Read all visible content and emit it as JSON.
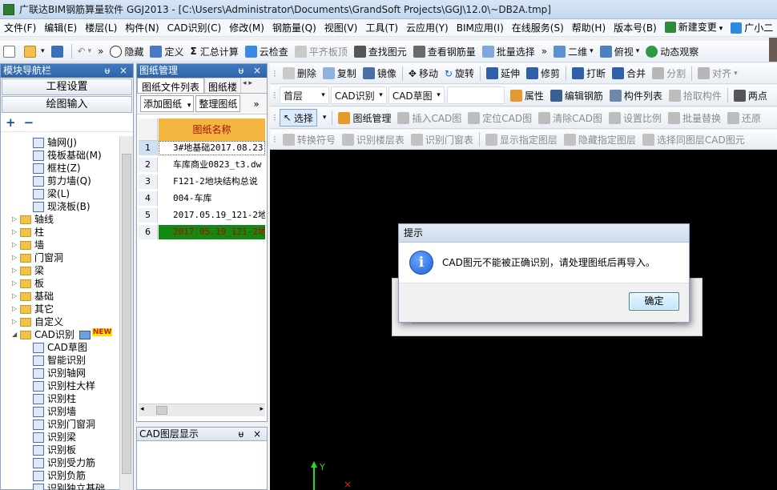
{
  "window": {
    "title": "广联达BIM钢筋算量软件 GGJ2013 - [C:\\Users\\Administrator\\Documents\\GrandSoft Projects\\GGJ\\12.0\\~DB2A.tmp]"
  },
  "menu": [
    "文件(F)",
    "编辑(E)",
    "楼层(L)",
    "构件(N)",
    "CAD识别(C)",
    "修改(M)",
    "钢筋量(Q)",
    "视图(V)",
    "工具(T)",
    "云应用(Y)",
    "BIM应用(I)",
    "在线服务(S)",
    "帮助(H)",
    "版本号(B)",
    "新建变更",
    "广小二"
  ],
  "toolbar1": {
    "items": [
      "隐藏",
      "定义",
      "汇总计算",
      "云检查",
      "平齐板顶",
      "查找图元",
      "查看钢筋量",
      "批量选择",
      "二维",
      "俯视",
      "动态观察"
    ]
  },
  "toolbar2": {
    "items": [
      "删除",
      "复制",
      "镜像",
      "移动",
      "旋转",
      "延伸",
      "修剪",
      "打断",
      "合并",
      "分割",
      "对齐"
    ]
  },
  "toolbar3": {
    "floor": "首层",
    "cad_mode": "CAD识别",
    "cad_type": "CAD草图",
    "items": [
      "属性",
      "编辑钢筋",
      "构件列表",
      "拾取构件",
      "两点"
    ]
  },
  "toolbar4": {
    "select": "选择",
    "items": [
      "图纸管理",
      "插入CAD图",
      "定位CAD图",
      "清除CAD图",
      "设置比例",
      "批量替换",
      "还原"
    ]
  },
  "toolbar5": {
    "items": [
      "转换符号",
      "识别楼层表",
      "识别门窗表",
      "显示指定图层",
      "隐藏指定图层",
      "选择同图层CAD图元"
    ]
  },
  "module_nav": {
    "title": "模块导航栏",
    "btn_project": "工程设置",
    "btn_draw": "绘图输入",
    "plus": "+",
    "minus": "−",
    "tree": [
      {
        "label": "轴网(J)",
        "level": 2,
        "type": "leaf"
      },
      {
        "label": "筏板基础(M)",
        "level": 2,
        "type": "leaf"
      },
      {
        "label": "框柱(Z)",
        "level": 2,
        "type": "leaf"
      },
      {
        "label": "剪力墙(Q)",
        "level": 2,
        "type": "leaf"
      },
      {
        "label": "梁(L)",
        "level": 2,
        "type": "leaf"
      },
      {
        "label": "现浇板(B)",
        "level": 2,
        "type": "leaf"
      },
      {
        "label": "轴线",
        "level": 1,
        "type": "folder"
      },
      {
        "label": "柱",
        "level": 1,
        "type": "folder"
      },
      {
        "label": "墙",
        "level": 1,
        "type": "folder"
      },
      {
        "label": "门窗洞",
        "level": 1,
        "type": "folder"
      },
      {
        "label": "梁",
        "level": 1,
        "type": "folder"
      },
      {
        "label": "板",
        "level": 1,
        "type": "folder"
      },
      {
        "label": "基础",
        "level": 1,
        "type": "folder"
      },
      {
        "label": "其它",
        "level": 1,
        "type": "folder"
      },
      {
        "label": "自定义",
        "level": 1,
        "type": "folder"
      },
      {
        "label": "CAD识别",
        "level": 1,
        "type": "folder",
        "open": true,
        "badge": "NEW"
      },
      {
        "label": "CAD草图",
        "level": 2,
        "type": "leaf"
      },
      {
        "label": "智能识别",
        "level": 2,
        "type": "leaf"
      },
      {
        "label": "识别轴网",
        "level": 2,
        "type": "leaf"
      },
      {
        "label": "识别柱大样",
        "level": 2,
        "type": "leaf"
      },
      {
        "label": "识别柱",
        "level": 2,
        "type": "leaf"
      },
      {
        "label": "识别墙",
        "level": 2,
        "type": "leaf"
      },
      {
        "label": "识别门窗洞",
        "level": 2,
        "type": "leaf"
      },
      {
        "label": "识别梁",
        "level": 2,
        "type": "leaf"
      },
      {
        "label": "识别板",
        "level": 2,
        "type": "leaf"
      },
      {
        "label": "识别受力筋",
        "level": 2,
        "type": "leaf"
      },
      {
        "label": "识别负筋",
        "level": 2,
        "type": "leaf"
      },
      {
        "label": "识别独立基础",
        "level": 2,
        "type": "leaf"
      }
    ]
  },
  "drawing_mgmt": {
    "title": "图纸管理",
    "tab_files": "图纸文件列表",
    "tab_floor": "图纸楼",
    "btn_add": "添加图纸",
    "btn_arrange": "整理图纸",
    "col_header": "图纸名称",
    "rows": [
      {
        "num": "1",
        "name": "3#地基础2017.08.23"
      },
      {
        "num": "2",
        "name": "车库商业0823_t3.dw"
      },
      {
        "num": "3",
        "name": "F121-2地块结构总说"
      },
      {
        "num": "4",
        "name": "004-车库"
      },
      {
        "num": "5",
        "name": "2017.05.19_121-2地"
      },
      {
        "num": "6",
        "name": "2017.05.19_121-2地"
      }
    ]
  },
  "cad_layer": {
    "title": "CAD图层显示"
  },
  "axis": {
    "y": "Y"
  },
  "dialog": {
    "title": "提示",
    "message": "CAD图元不能被正确识别，请处理图纸后再导入。",
    "ok": "确定"
  },
  "colors": {
    "panel_header": "#2f64a8",
    "selected_row": "#128a12",
    "canvas": "#000000",
    "progress": "#2fbf3a"
  }
}
